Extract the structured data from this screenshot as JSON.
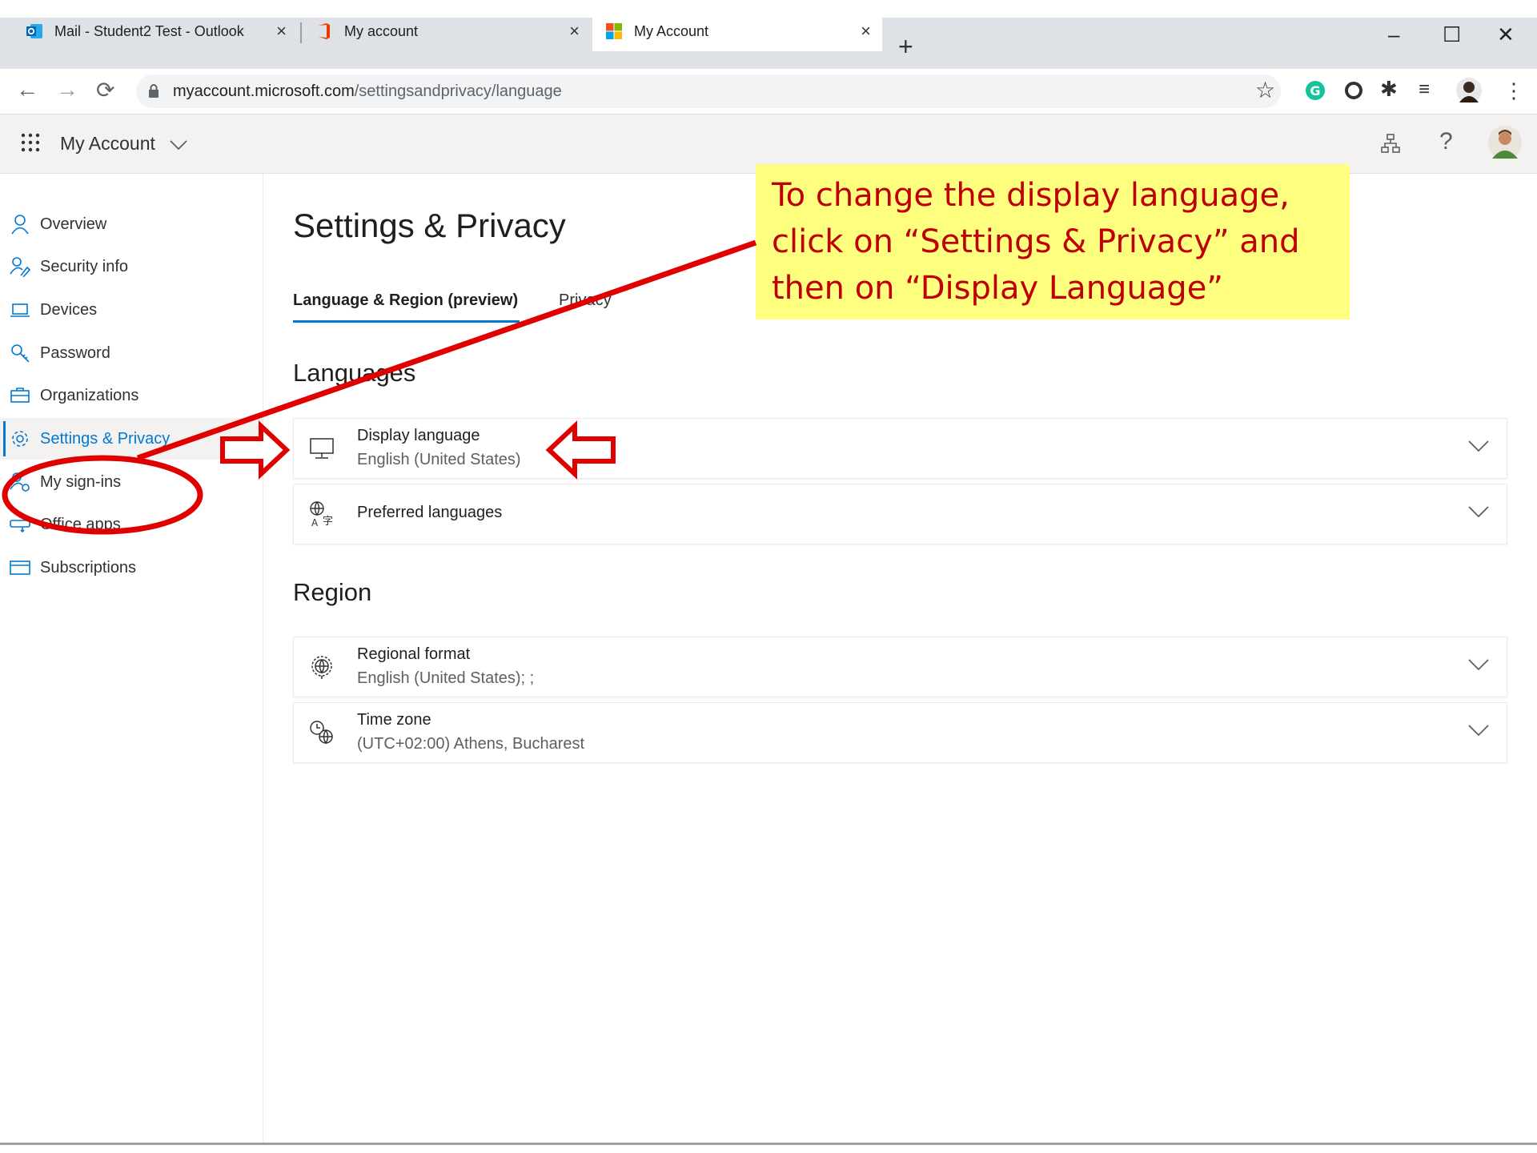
{
  "browser": {
    "tabs": [
      {
        "label": "Mail - Student2 Test - Outlook",
        "close": "×"
      },
      {
        "label": "My account",
        "close": "×"
      },
      {
        "label": "My Account",
        "close": "×"
      }
    ],
    "new_tab": "+",
    "window_controls": {
      "minimize": "–",
      "maximize": "☐",
      "close": "✕"
    },
    "url_host": "myaccount.microsoft.com",
    "url_path": "/settingsandprivacy/language"
  },
  "header": {
    "app_name": "My Account",
    "help": "?"
  },
  "sidebar": {
    "items": [
      {
        "label": "Overview",
        "icon": "person-icon"
      },
      {
        "label": "Security info",
        "icon": "person-key-icon"
      },
      {
        "label": "Devices",
        "icon": "laptop-icon"
      },
      {
        "label": "Password",
        "icon": "key-icon"
      },
      {
        "label": "Organizations",
        "icon": "briefcase-icon"
      },
      {
        "label": "Settings & Privacy",
        "icon": "gear-icon",
        "selected": true
      },
      {
        "label": "My sign-ins",
        "icon": "person-key-icon"
      },
      {
        "label": "Office apps",
        "icon": "office-apps-icon"
      },
      {
        "label": "Subscriptions",
        "icon": "card-icon"
      }
    ]
  },
  "main": {
    "title": "Settings & Privacy",
    "tabs": [
      {
        "label": "Language & Region (preview)",
        "active": true
      },
      {
        "label": "Privacy"
      }
    ],
    "languages_heading": "Languages",
    "display_language": {
      "title": "Display language",
      "value": "English (United States)"
    },
    "preferred_languages": {
      "title": "Preferred languages"
    },
    "region_heading": "Region",
    "regional_format": {
      "title": "Regional format",
      "value": "English (United States); ;"
    },
    "time_zone": {
      "title": "Time zone",
      "value": "(UTC+02:00) Athens, Bucharest"
    }
  },
  "annotation": {
    "lines": [
      "To change the display language,",
      "click on “Settings & Privacy” and",
      "then on “Display Language”"
    ],
    "colors": {
      "text": "#c00000",
      "background": "#ffff7f",
      "marker": "#e00000"
    }
  },
  "colors": {
    "accent": "#0078d4"
  }
}
